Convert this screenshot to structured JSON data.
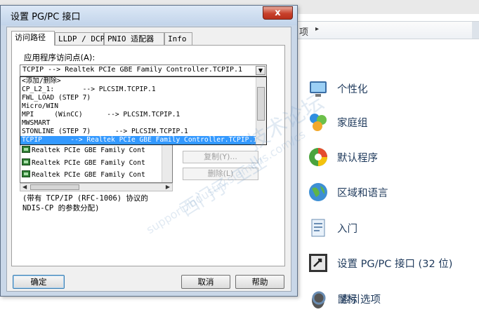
{
  "background": {
    "address_crumb": "项",
    "address_arrow": "▸",
    "items": [
      {
        "label": "个性化",
        "icon": "personalization-icon"
      },
      {
        "label": "家庭组",
        "icon": "homegroup-icon"
      },
      {
        "label": "默认程序",
        "icon": "default-programs-icon"
      },
      {
        "label": "区域和语言",
        "icon": "region-language-icon"
      },
      {
        "label": "入门",
        "icon": "getting-started-icon"
      },
      {
        "label": "设置 PG/PC 接口 (32 位)",
        "icon": "pgpc-interface-icon"
      },
      {
        "label": "鼠标",
        "icon": "mouse-icon"
      },
      {
        "label": "索引选项",
        "icon": "indexing-options-icon"
      }
    ]
  },
  "dialog": {
    "title": "设置 PG/PC 接口",
    "close_glyph": "x",
    "tabs": [
      "访问路径",
      "LLDP / DCP",
      "PNIO 适配器",
      "Info"
    ],
    "access_point_label": "应用程序访问点(A):",
    "combo_value": "TCPIP       --> Realtek PCIe GBE Family Controller.TCPIP.1",
    "dropdown_items": [
      "<添加/删除>",
      "CP_L2_1:       --> PLCSIM.TCPIP.1",
      "FWL_LOAD (STEP 7)",
      "Micro/WIN",
      "MPI     (WinCC)      --> PLCSIM.TCPIP.1",
      "MWSMART",
      "STONLINE (STEP 7)      --> PLCSIM.TCPIP.1",
      "TCPIP       --> Realtek PCIe GBE Family Controller.TCPIP.1"
    ],
    "selected_index": 7,
    "interface_list": [
      "Realtek PCIe GBE Family Cont",
      "Realtek PCIe GBE Family Cont"
    ],
    "side_buttons": [
      "复制(Y)...",
      "删除(L)"
    ],
    "note_line1": "(带有 TCP/IP (RFC-1006) 协议的",
    "note_line2": "NDIS-CP 的参数分配)",
    "buttons": {
      "ok": "确定",
      "cancel": "取消",
      "help": "帮助"
    }
  },
  "watermark": [
    "西门子",
    "工业",
    "技术论坛",
    "support.industry.siemens.com/cs"
  ],
  "colors": {
    "selection": "#3399ff",
    "link_text": "#1e395b",
    "close_red": "#c7402b"
  }
}
